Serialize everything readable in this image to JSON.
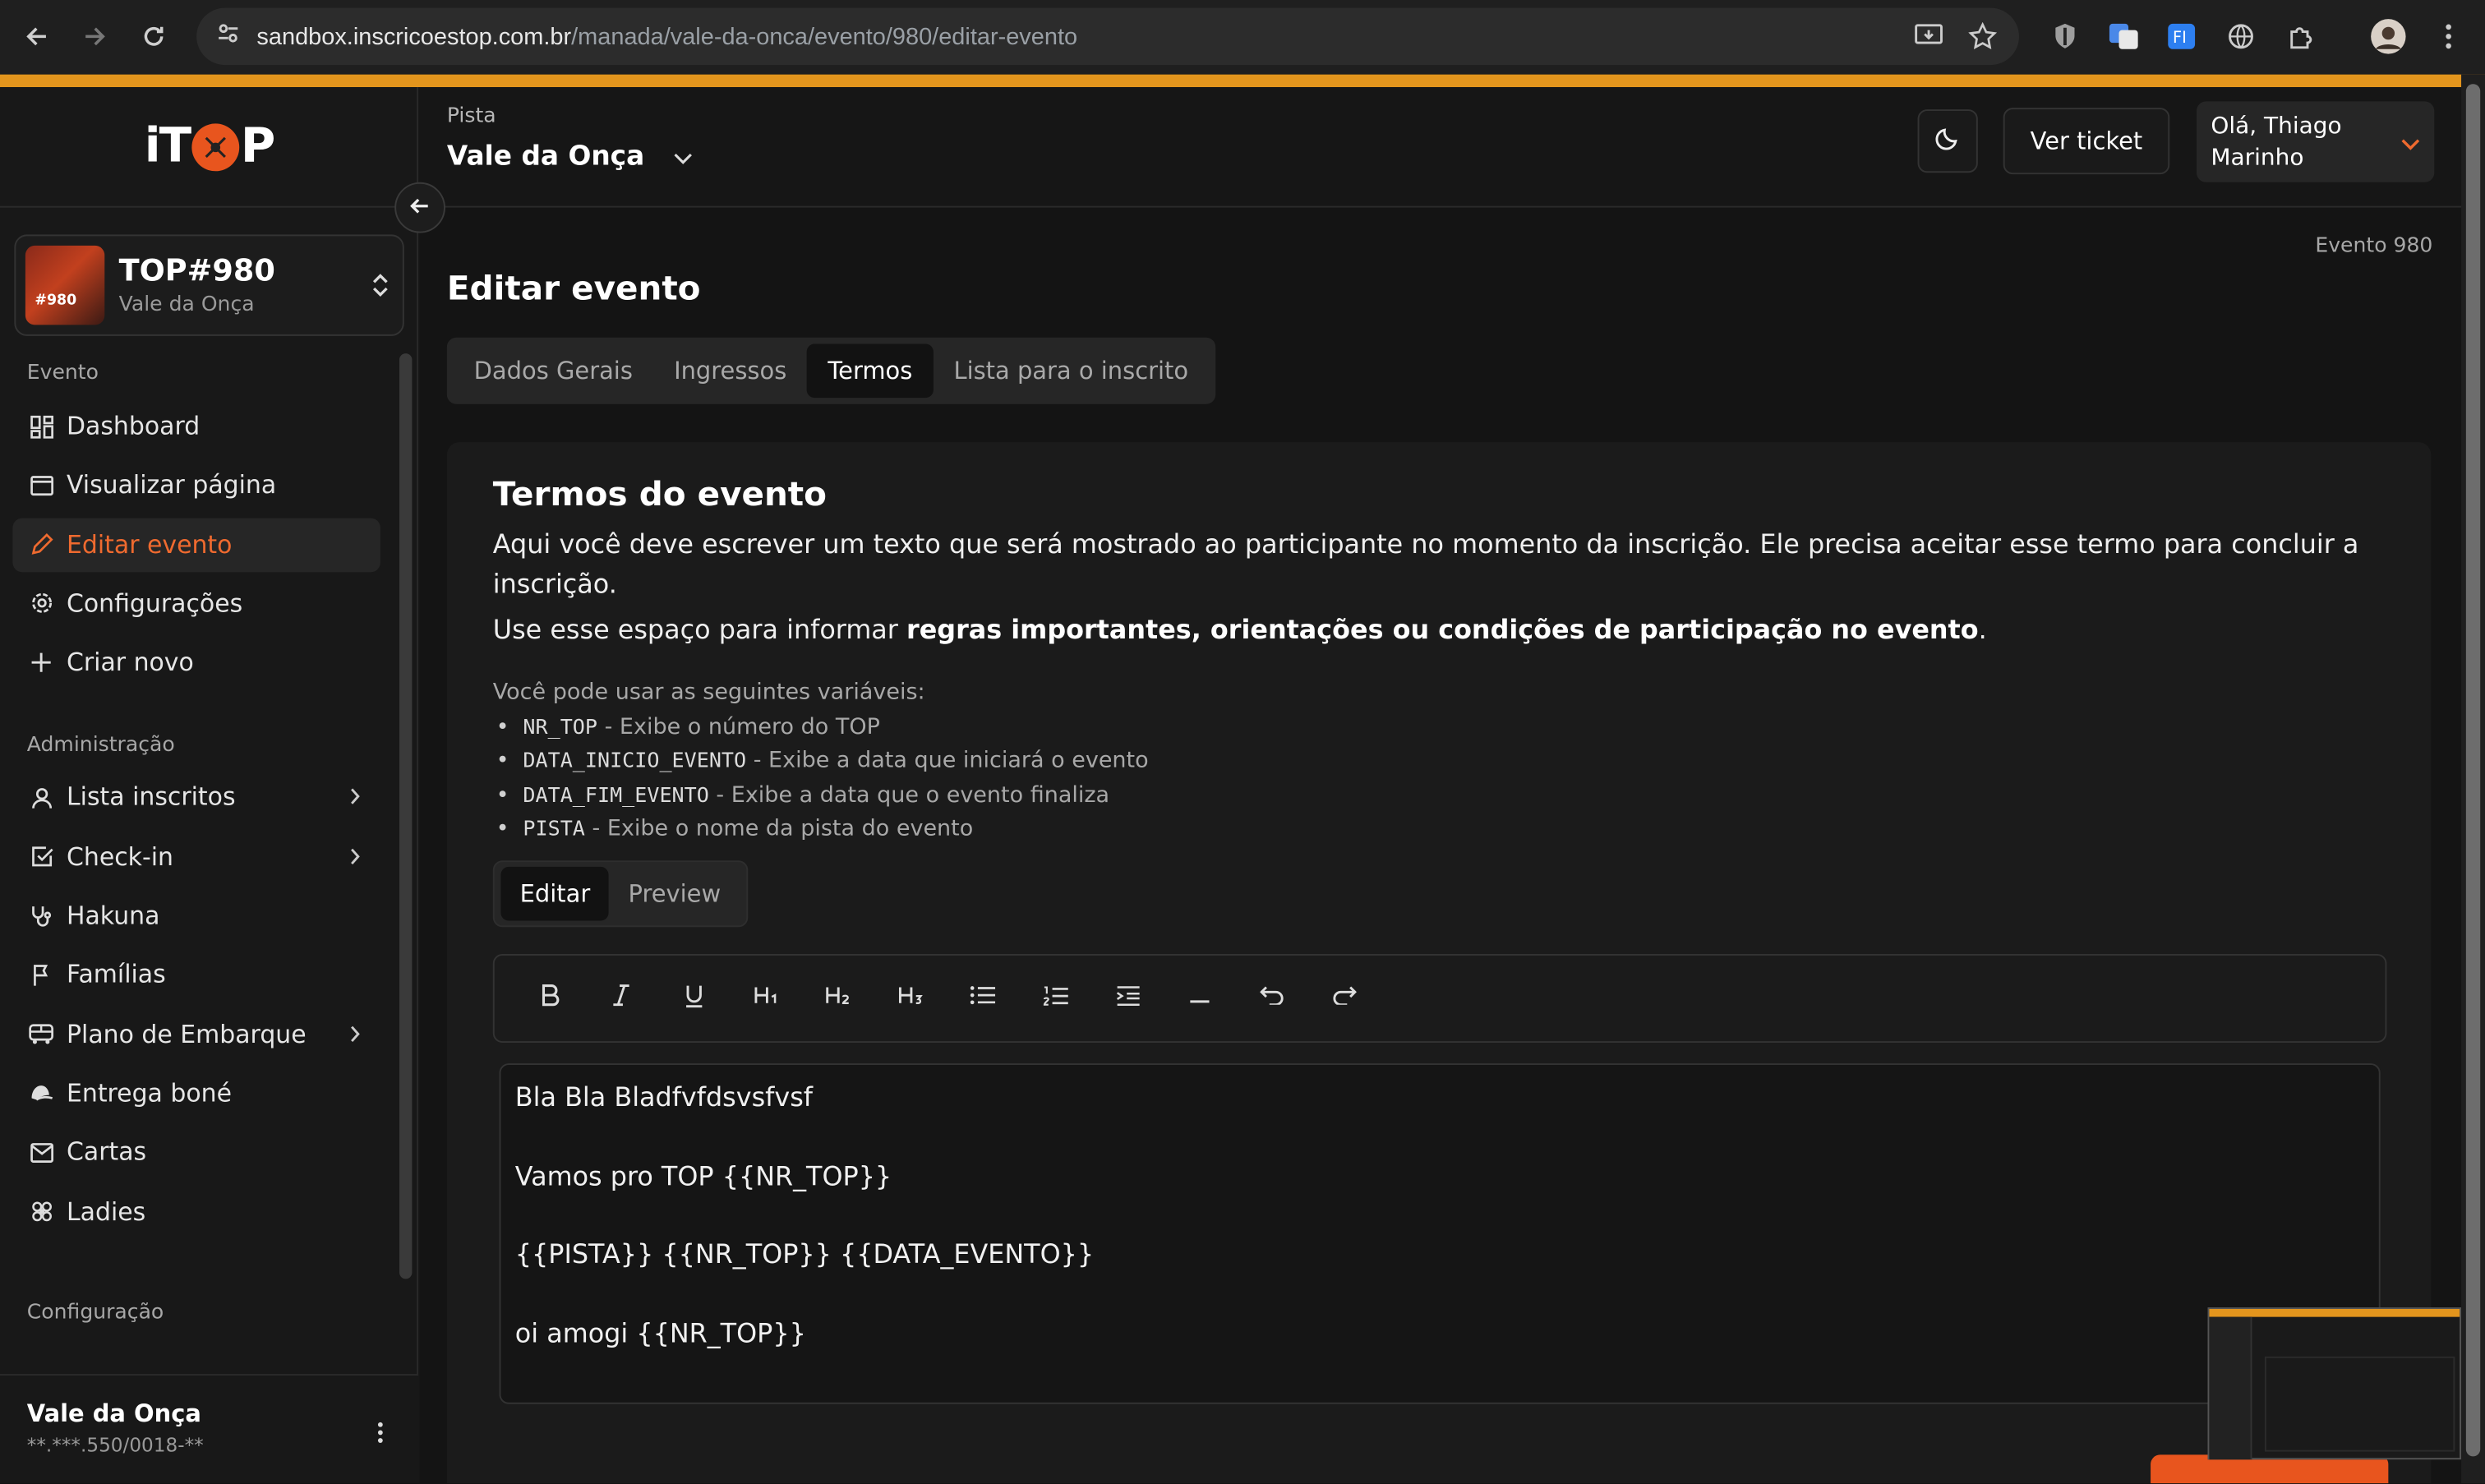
{
  "browser": {
    "url_host": "sandbox.inscricoestop.com.br",
    "url_path": "/manada/vale-da-onca/evento/980/editar-evento"
  },
  "brand": {
    "logo_text_left": "iT",
    "logo_text_right": "P"
  },
  "colors": {
    "accent": "#ef6a2f",
    "brand_orange": "#e8551e",
    "chrome_bar": "#e3951d"
  },
  "event": {
    "title": "TOP#980",
    "subtitle": "Vale da Onça",
    "thumb_label": "#980"
  },
  "sidebar": {
    "groups": [
      {
        "label": "Evento",
        "items": [
          {
            "label": "Dashboard",
            "icon": "dashboard-icon"
          },
          {
            "label": "Visualizar página",
            "icon": "page-icon"
          },
          {
            "label": "Editar evento",
            "icon": "pencil-icon",
            "active": true
          },
          {
            "label": "Configurações",
            "icon": "gear-icon"
          },
          {
            "label": "Criar novo",
            "icon": "plus-icon"
          }
        ]
      },
      {
        "label": "Administração",
        "items": [
          {
            "label": "Lista inscritos",
            "icon": "user-icon",
            "chevron": true
          },
          {
            "label": "Check-in",
            "icon": "checkbox-icon",
            "chevron": true
          },
          {
            "label": "Hakuna",
            "icon": "stethoscope-icon"
          },
          {
            "label": "Famílias",
            "icon": "flag-icon"
          },
          {
            "label": "Plano de Embarque",
            "icon": "bus-icon",
            "chevron": true
          },
          {
            "label": "Entrega boné",
            "icon": "cap-icon"
          },
          {
            "label": "Cartas",
            "icon": "mail-icon"
          },
          {
            "label": "Ladies",
            "icon": "flower-icon"
          }
        ]
      },
      {
        "label": "Configuração",
        "items": []
      }
    ],
    "footer": {
      "name": "Vale da Onça",
      "document": "**.***.550/0018-**"
    }
  },
  "header": {
    "pista_label": "Pista",
    "pista_value": "Vale da Onça",
    "ticket_button": "Ver ticket",
    "greeting_line1": "Olá, Thiago",
    "greeting_line2": "Marinho"
  },
  "main": {
    "breadcrumb": "Evento 980",
    "title": "Editar evento",
    "tabs": [
      "Dados Gerais",
      "Ingressos",
      "Termos",
      "Lista para o inscrito"
    ],
    "active_tab": "Termos",
    "terms": {
      "title": "Termos do evento",
      "description": "Aqui você deve escrever um texto que será mostrado ao participante no momento da inscrição. Ele precisa aceitar esse termo para concluir a inscrição.",
      "description2_prefix": "Use esse espaço para informar ",
      "description2_bold": "regras importantes, orientações ou condições de participação no evento",
      "description2_suffix": ".",
      "vars_intro": "Você pode usar as seguintes variáveis:",
      "vars": [
        {
          "name": "NR_TOP",
          "desc": " - Exibe o número do TOP"
        },
        {
          "name": "DATA_INICIO_EVENTO",
          "desc": " - Exibe a data que iniciará o evento"
        },
        {
          "name": "DATA_FIM_EVENTO",
          "desc": " - Exibe a data que o evento finaliza"
        },
        {
          "name": "PISTA",
          "desc": " - Exibe o nome da pista do evento"
        }
      ]
    },
    "mode_tabs": [
      "Editar",
      "Preview"
    ],
    "active_mode": "Editar",
    "editor_lines": [
      "Bla Bla Bladfvfdsvsfvsf",
      "Vamos pro TOP {{NR_TOP}}",
      "{{PISTA}} {{NR_TOP}} {{DATA_EVENTO}}",
      "oi amogi {{NR_TOP}}"
    ]
  }
}
